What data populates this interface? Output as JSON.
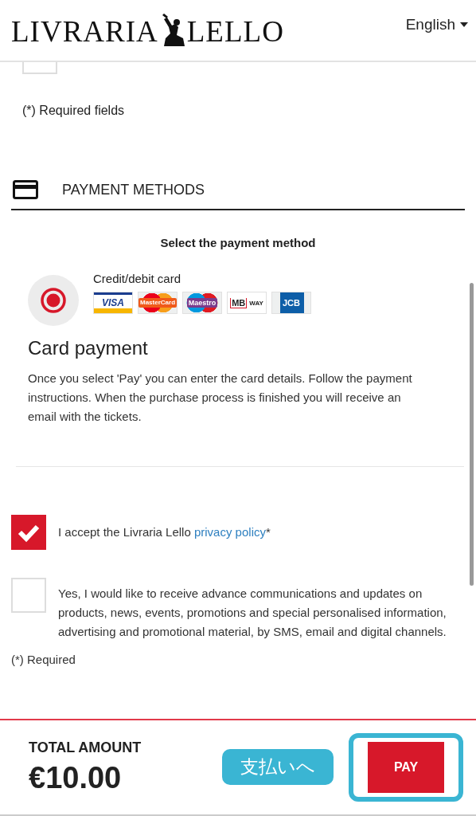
{
  "header": {
    "logo": [
      "LIVRARIA",
      "LELLO"
    ],
    "language": "English"
  },
  "previous_section": {
    "checkbox_checked": false,
    "note": "(*) Required fields"
  },
  "payment_methods": {
    "heading": "PAYMENT METHODS",
    "prompt": "Select the payment method",
    "options": [
      {
        "label": "Credit/debit card",
        "selected": true,
        "brands": [
          {
            "kind": "visa",
            "label": "VISA"
          },
          {
            "kind": "mastercard",
            "label": "MasterCard"
          },
          {
            "kind": "maestro",
            "label": "Maestro"
          },
          {
            "kind": "mbway",
            "label": "MB",
            "suffix": "WAY"
          },
          {
            "kind": "jcb",
            "label": "JCB"
          }
        ]
      }
    ],
    "title": "Card payment",
    "description": "Once you select 'Pay' you can enter the card details. Follow the payment instructions. When the purchase process is finished you will receive an email with the tickets."
  },
  "consents": [
    {
      "text": "I accept the Livraria Lello ",
      "link": "privacy policy",
      "suffix": "*",
      "checked": true
    },
    {
      "text": "Yes, I would like to receive advance communications and updates on products, news, events, promotions and special personalised information, advertising and promotional material, by SMS, email and digital channels.",
      "checked": false
    }
  ],
  "required_note": "(*) Required",
  "footer": {
    "total_label": "TOTAL AMOUNT",
    "total": "€10.00",
    "pay_button": "PAY",
    "pay_highlighted": true
  },
  "annotation": {
    "label": "支払いへ"
  }
}
